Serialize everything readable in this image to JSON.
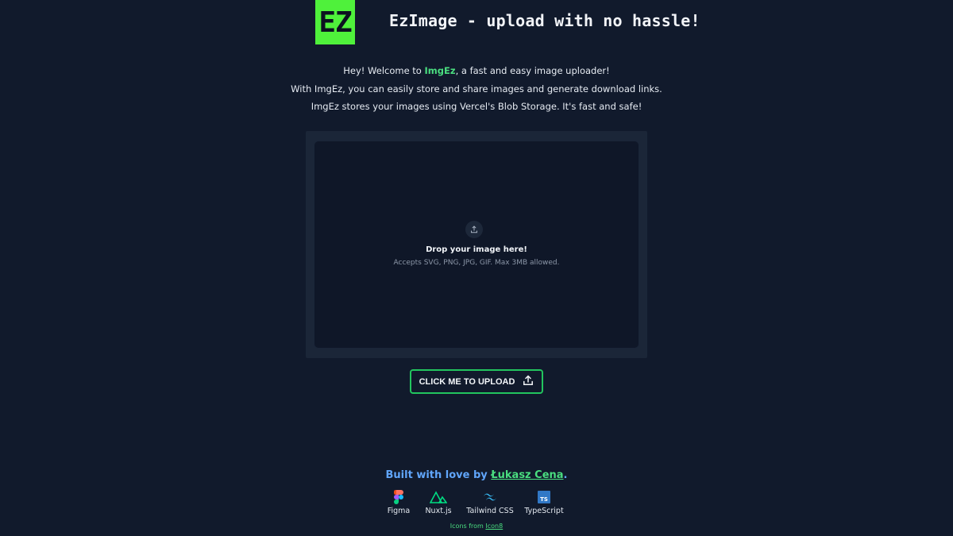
{
  "header": {
    "logo_text": "EZ",
    "title": "EzImage - upload with no hassle!",
    "logo_color": "#4ff13b"
  },
  "intro": {
    "line1_pre": "Hey! Welcome to ",
    "brand": "ImgEz",
    "line1_post": ", a fast and easy image uploader!",
    "line2": "With ImgEz, you can easily store and share images and generate download links.",
    "line3": "ImgEz stores your images using Vercel's Blob Storage. It's fast and safe!"
  },
  "dropzone": {
    "icon": "upload-icon",
    "title": "Drop your image here!",
    "subtitle": "Accepts SVG, PNG, JPG, GIF. Max 3MB allowed."
  },
  "upload_button": {
    "label": "CLICK ME TO UPLOAD",
    "icon": "upload-icon",
    "accent": "#22c55e"
  },
  "footer": {
    "built_pre": "Built with love by ",
    "author": "Łukasz Cena",
    "built_post": ".",
    "tech": [
      {
        "label": "Figma",
        "icon": "figma-icon"
      },
      {
        "label": "Nuxt.js",
        "icon": "nuxt-icon"
      },
      {
        "label": "Tailwind CSS",
        "icon": "tailwind-icon"
      },
      {
        "label": "TypeScript",
        "icon": "typescript-icon"
      }
    ],
    "icons_from_pre": "Icons from ",
    "icons_from_link": "Icon8"
  }
}
